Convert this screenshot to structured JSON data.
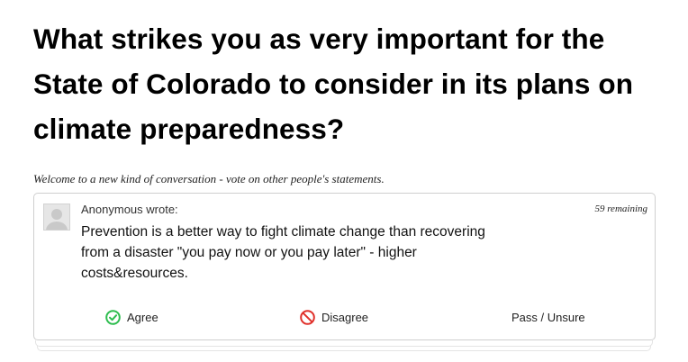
{
  "page": {
    "title": "What strikes you as very important for the State of Colorado to consider in its plans on climate preparedness?",
    "intro": "Welcome to a new kind of conversation - vote on other people's statements."
  },
  "card": {
    "author": "Anonymous wrote:",
    "remaining": "59 remaining",
    "statement": "Prevention is a better way to fight climate change than recovering from a disaster \"you pay now or you pay later\" - higher costs&resources.",
    "actions": {
      "agree": "Agree",
      "disagree": "Disagree",
      "pass": "Pass / Unsure"
    }
  },
  "colors": {
    "agree": "#2ebd4f",
    "disagree": "#e0302a"
  },
  "icons": {
    "avatar": "default-avatar-icon",
    "agree": "check-circle-icon",
    "disagree": "prohibited-icon"
  }
}
